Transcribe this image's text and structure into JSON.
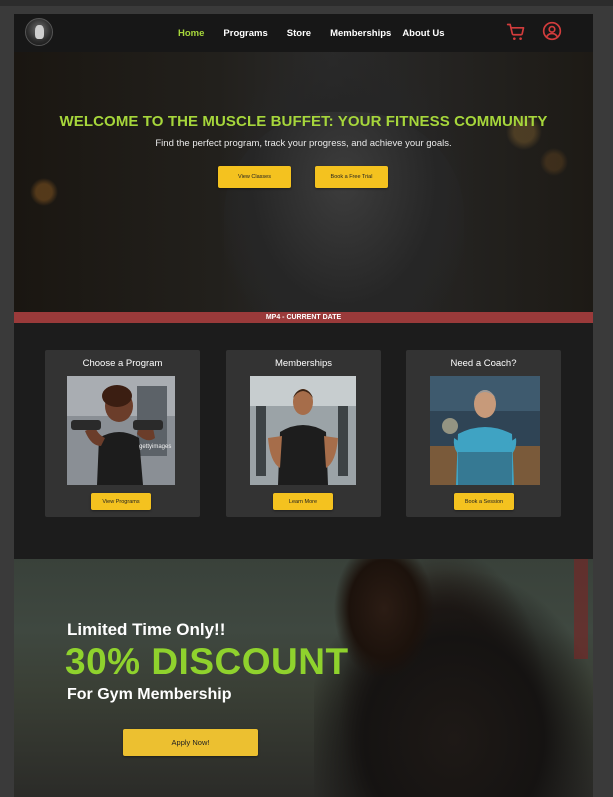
{
  "nav": {
    "logo": "logo",
    "links": [
      "Home",
      "Programs",
      "Store",
      "Memberships",
      "About Us"
    ],
    "active": "Home",
    "cart_icon": "cart-icon",
    "user_icon": "user-icon"
  },
  "hero": {
    "title": "WELCOME TO THE MUSCLE BUFFET: YOUR FITNESS COMMUNITY",
    "subtitle": "Find the perfect program, track your progress, and achieve your goals.",
    "btn_classes": "View Classes",
    "btn_trial": "Book a Free Trial"
  },
  "date_bar": "MP4 - CURRENT DATE",
  "cards": [
    {
      "title": "Choose a Program",
      "button": "View Programs",
      "watermark": "gettyimages"
    },
    {
      "title": "Memberships",
      "button": "Learn More"
    },
    {
      "title": "Need a Coach?",
      "button": "Book a Session"
    }
  ],
  "promo": {
    "kicker": "Limited Time Only!!",
    "headline": "30% DISCOUNT",
    "subline": "For Gym Membership",
    "button": "Apply Now!"
  },
  "colors": {
    "accent_green": "#a6d63b",
    "button_yellow": "#f4c21f",
    "date_bar": "#9a3a3a",
    "icon_red": "#d23c3c"
  }
}
